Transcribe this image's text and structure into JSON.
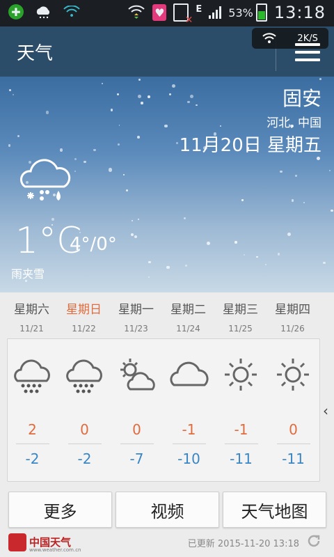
{
  "statusbar": {
    "network_type": "E",
    "battery_percent": "53%",
    "time": "13:18"
  },
  "appbar": {
    "title": "天气",
    "speed": "2K/S"
  },
  "hero": {
    "city": "固安",
    "region": "河北, 中国",
    "date": "11月20日 星期五",
    "current_temp": "1°C",
    "range": "4°/0°",
    "condition": "雨夹雪",
    "icon": "sleet-cloud-icon"
  },
  "forecast": [
    {
      "day": "星期六",
      "date": "11/21",
      "icon": "snow-cloud-icon",
      "high": "2",
      "low": "-2",
      "highlight": false
    },
    {
      "day": "星期日",
      "date": "11/22",
      "icon": "snow-cloud-icon",
      "high": "0",
      "low": "-2",
      "highlight": true
    },
    {
      "day": "星期一",
      "date": "11/23",
      "icon": "partly-cloudy-icon",
      "high": "0",
      "low": "-7",
      "highlight": false
    },
    {
      "day": "星期二",
      "date": "11/24",
      "icon": "cloud-icon",
      "high": "-1",
      "low": "-10",
      "highlight": false
    },
    {
      "day": "星期三",
      "date": "11/25",
      "icon": "sun-icon",
      "high": "-1",
      "low": "-11",
      "highlight": false
    },
    {
      "day": "星期四",
      "date": "11/26",
      "icon": "sun-icon",
      "high": "0",
      "low": "-11",
      "highlight": false
    }
  ],
  "buttons": {
    "more": "更多",
    "video": "视频",
    "map": "天气地图"
  },
  "footer": {
    "logo_text": "中国天气",
    "logo_url": "www.weather.com.cn",
    "updated": "已更新 2015-11-20 13:18"
  },
  "colors": {
    "high_temp": "#e06b3c",
    "low_temp": "#3a86c4",
    "appbar": "#2b4d6a"
  }
}
